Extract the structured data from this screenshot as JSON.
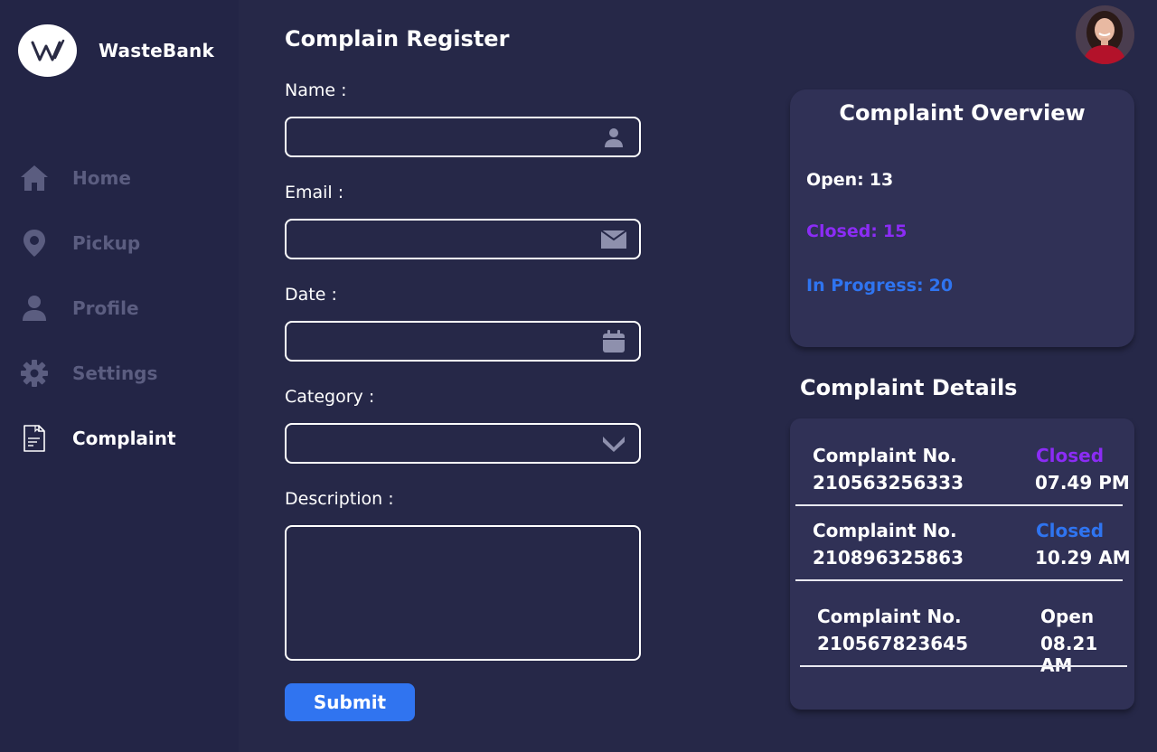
{
  "brand": {
    "name": "WasteBank",
    "logo_text": "W"
  },
  "sidebar": {
    "items": [
      {
        "label": "Home",
        "icon": "home-icon",
        "active": false
      },
      {
        "label": "Pickup",
        "icon": "location-pin-icon",
        "active": false
      },
      {
        "label": "Profile",
        "icon": "user-icon",
        "active": false
      },
      {
        "label": "Settings",
        "icon": "gear-icon",
        "active": false
      },
      {
        "label": "Complaint",
        "icon": "document-icon",
        "active": true
      }
    ]
  },
  "form": {
    "title": "Complain Register",
    "name_label": "Name :",
    "name_value": "",
    "email_label": "Email :",
    "email_value": "",
    "date_label": "Date :",
    "date_value": "",
    "category_label": "Category :",
    "category_value": "",
    "description_label": "Description :",
    "description_value": "",
    "submit_label": "Submit"
  },
  "overview": {
    "title": "Complaint Overview",
    "open_label": "Open:",
    "open_value": "13",
    "closed_label": "Closed:",
    "closed_value": "15",
    "progress_label": "In Progress:",
    "progress_value": "20"
  },
  "details": {
    "title": "Complaint Details",
    "rows": [
      {
        "label": "Complaint No.",
        "number": "210563256333",
        "status": "Closed",
        "time": "07.49 PM",
        "status_color": "#8b2cf5"
      },
      {
        "label": "Complaint No.",
        "number": "210896325863",
        "status": "Closed",
        "time": "10.29 AM",
        "status_color": "#2f74f0"
      },
      {
        "label": "Complaint No.",
        "number": "210567823645",
        "status": "Open",
        "time": "08.21 AM",
        "status_color": "#ffffff"
      }
    ]
  },
  "colors": {
    "background": "#262848",
    "sidebar": "#232546",
    "card": "#303156",
    "accent_blue": "#3074f0",
    "closed_purple": "#8b2cf5",
    "in_progress_blue": "#2f74f0",
    "inactive_nav": "#5b5d80"
  }
}
